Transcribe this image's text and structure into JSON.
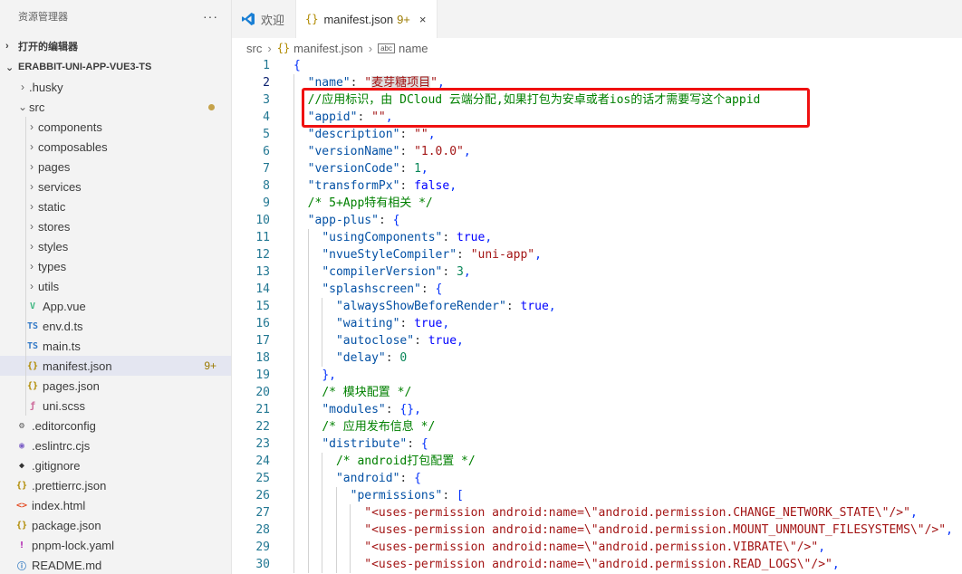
{
  "explorer": {
    "title": "资源管理器",
    "more": "···",
    "open_editors": "打开的编辑器",
    "project": "ERABBIT-UNI-APP-VUE3-TS",
    "items": [
      {
        "label": ".husky",
        "kind": "folder",
        "depth": 1,
        "open": false
      },
      {
        "label": "src",
        "kind": "folder",
        "depth": 1,
        "open": true,
        "modified": true
      },
      {
        "label": "components",
        "kind": "folder",
        "depth": 2,
        "open": false
      },
      {
        "label": "composables",
        "kind": "folder",
        "depth": 2,
        "open": false
      },
      {
        "label": "pages",
        "kind": "folder",
        "depth": 2,
        "open": false
      },
      {
        "label": "services",
        "kind": "folder",
        "depth": 2,
        "open": false
      },
      {
        "label": "static",
        "kind": "folder",
        "depth": 2,
        "open": false
      },
      {
        "label": "stores",
        "kind": "folder",
        "depth": 2,
        "open": false
      },
      {
        "label": "styles",
        "kind": "folder",
        "depth": 2,
        "open": false
      },
      {
        "label": "types",
        "kind": "folder",
        "depth": 2,
        "open": false
      },
      {
        "label": "utils",
        "kind": "folder",
        "depth": 2,
        "open": false
      },
      {
        "label": "App.vue",
        "kind": "vue",
        "depth": 2
      },
      {
        "label": "env.d.ts",
        "kind": "ts",
        "depth": 2
      },
      {
        "label": "main.ts",
        "kind": "ts",
        "depth": 2
      },
      {
        "label": "manifest.json",
        "kind": "json",
        "depth": 2,
        "selected": true,
        "badge": "9+"
      },
      {
        "label": "pages.json",
        "kind": "json",
        "depth": 2
      },
      {
        "label": "uni.scss",
        "kind": "scss",
        "depth": 2
      },
      {
        "label": ".editorconfig",
        "kind": "gear",
        "depth": 1
      },
      {
        "label": ".eslintrc.cjs",
        "kind": "eslint",
        "depth": 1
      },
      {
        "label": ".gitignore",
        "kind": "git",
        "depth": 1
      },
      {
        "label": ".prettierrc.json",
        "kind": "json",
        "depth": 1
      },
      {
        "label": "index.html",
        "kind": "html",
        "depth": 1
      },
      {
        "label": "package.json",
        "kind": "json",
        "depth": 1
      },
      {
        "label": "pnpm-lock.yaml",
        "kind": "yaml",
        "depth": 1
      },
      {
        "label": "README.md",
        "kind": "md",
        "depth": 1
      }
    ]
  },
  "tabs": [
    {
      "label": "欢迎",
      "icon": "vscode-icon",
      "active": false
    },
    {
      "label": "manifest.json",
      "icon": "json-icon",
      "active": true,
      "badge": "9+"
    }
  ],
  "breadcrumb": [
    "src",
    "manifest.json",
    "name"
  ],
  "icons": {
    "json": "{}",
    "ts": "TS",
    "vue": "V",
    "close": "×"
  },
  "colors": {
    "annotation_box": "#ef1111",
    "selected_row": "#e4e6f1"
  },
  "code_lines": [
    "{",
    "  \"name\": \"麦芽糖项目\",",
    "  //应用标识，由 DCloud 云端分配,如果打包为安卓或者ios的话才需要写这个appid",
    "  \"appid\": \"\",",
    "  \"description\": \"\",",
    "  \"versionName\": \"1.0.0\",",
    "  \"versionCode\": 1,",
    "  \"transformPx\": false,",
    "  /* 5+App特有相关 */",
    "  \"app-plus\": {",
    "    \"usingComponents\": true,",
    "    \"nvueStyleCompiler\": \"uni-app\",",
    "    \"compilerVersion\": 3,",
    "    \"splashscreen\": {",
    "      \"alwaysShowBeforeRender\": true,",
    "      \"waiting\": true,",
    "      \"autoclose\": true,",
    "      \"delay\": 0",
    "    },",
    "    /* 模块配置 */",
    "    \"modules\": {},",
    "    /* 应用发布信息 */",
    "    \"distribute\": {",
    "      /* android打包配置 */",
    "      \"android\": {",
    "        \"permissions\": [",
    "          \"<uses-permission android:name=\\\"android.permission.CHANGE_NETWORK_STATE\\\"/>\",",
    "          \"<uses-permission android:name=\\\"android.permission.MOUNT_UNMOUNT_FILESYSTEMS\\\"/>\",",
    "          \"<uses-permission android:name=\\\"android.permission.VIBRATE\\\"/>\",",
    "          \"<uses-permission android:name=\\\"android.permission.READ_LOGS\\\"/>\","
  ]
}
